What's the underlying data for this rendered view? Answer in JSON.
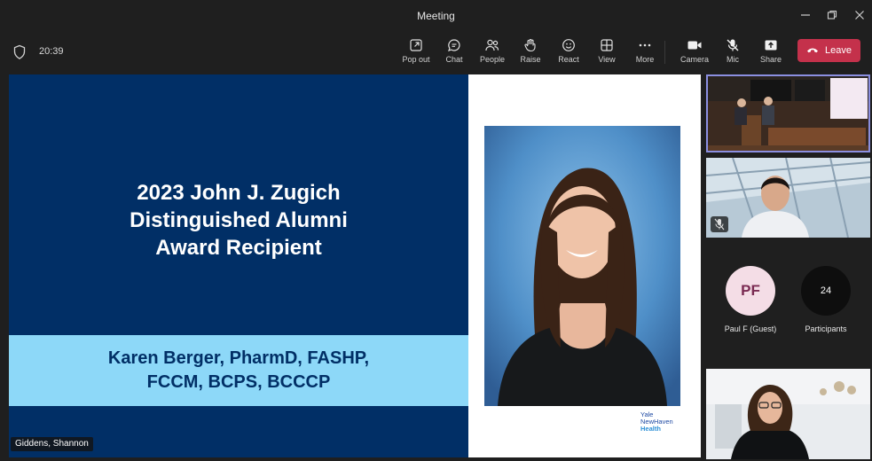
{
  "window": {
    "title": "Meeting"
  },
  "toolbar": {
    "time": "20:39",
    "buttons": [
      {
        "label": "Pop out",
        "icon": "pop-out-icon"
      },
      {
        "label": "Chat",
        "icon": "chat-icon"
      },
      {
        "label": "People",
        "icon": "people-icon"
      },
      {
        "label": "Raise",
        "icon": "raise-hand-icon"
      },
      {
        "label": "React",
        "icon": "react-icon"
      },
      {
        "label": "View",
        "icon": "view-icon"
      },
      {
        "label": "More",
        "icon": "more-icon"
      },
      {
        "label": "Camera",
        "icon": "camera-icon"
      },
      {
        "label": "Mic",
        "icon": "mic-off-icon"
      },
      {
        "label": "Share",
        "icon": "share-icon"
      }
    ],
    "leave_label": "Leave",
    "leave_color": "#c4314b"
  },
  "slide": {
    "title_lines": [
      "2023 John J. Zugich",
      "Distinguished Alumni",
      "Award Recipient"
    ],
    "name_lines": [
      "Karen Berger, PharmD, FASHP,",
      "FCCM, BCPS, BCCCP"
    ],
    "logo_lines": [
      "Yale",
      "NewHaven",
      "Health"
    ],
    "bg_color": "#012f66",
    "band_color": "#8dd8f8"
  },
  "active_speaker": "Giddens, Shannon",
  "participants": {
    "guest": {
      "initials": "PF",
      "name": "Paul F (Guest)"
    },
    "overflow": {
      "count": "24",
      "label": "Participants"
    }
  }
}
